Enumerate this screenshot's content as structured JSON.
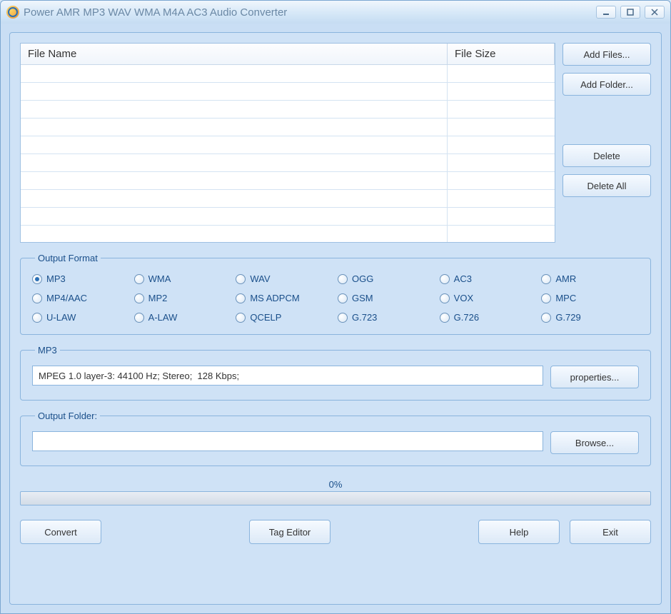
{
  "window": {
    "title": "Power AMR MP3 WAV WMA M4A AC3 Audio Converter"
  },
  "table": {
    "columns": {
      "name": "File Name",
      "size": "File Size"
    },
    "rows": []
  },
  "side": {
    "add_files": "Add Files...",
    "add_folder": "Add Folder...",
    "delete": "Delete",
    "delete_all": "Delete All"
  },
  "output_format": {
    "legend": "Output Format",
    "selected": "MP3",
    "options": [
      "MP3",
      "WMA",
      "WAV",
      "OGG",
      "AC3",
      "AMR",
      "MP4/AAC",
      "MP2",
      "MS ADPCM",
      "GSM",
      "VOX",
      "MPC",
      "U-LAW",
      "A-LAW",
      "QCELP",
      "G.723",
      "G.726",
      "G.729"
    ]
  },
  "codec": {
    "legend": "MP3",
    "info": "MPEG 1.0 layer-3: 44100 Hz; Stereo;  128 Kbps;",
    "properties_btn": "properties..."
  },
  "output_folder": {
    "legend": "Output Folder:",
    "path": "",
    "browse_btn": "Browse..."
  },
  "progress": {
    "label": "0%"
  },
  "bottom": {
    "convert": "Convert",
    "tag_editor": "Tag Editor",
    "help": "Help",
    "exit": "Exit"
  }
}
